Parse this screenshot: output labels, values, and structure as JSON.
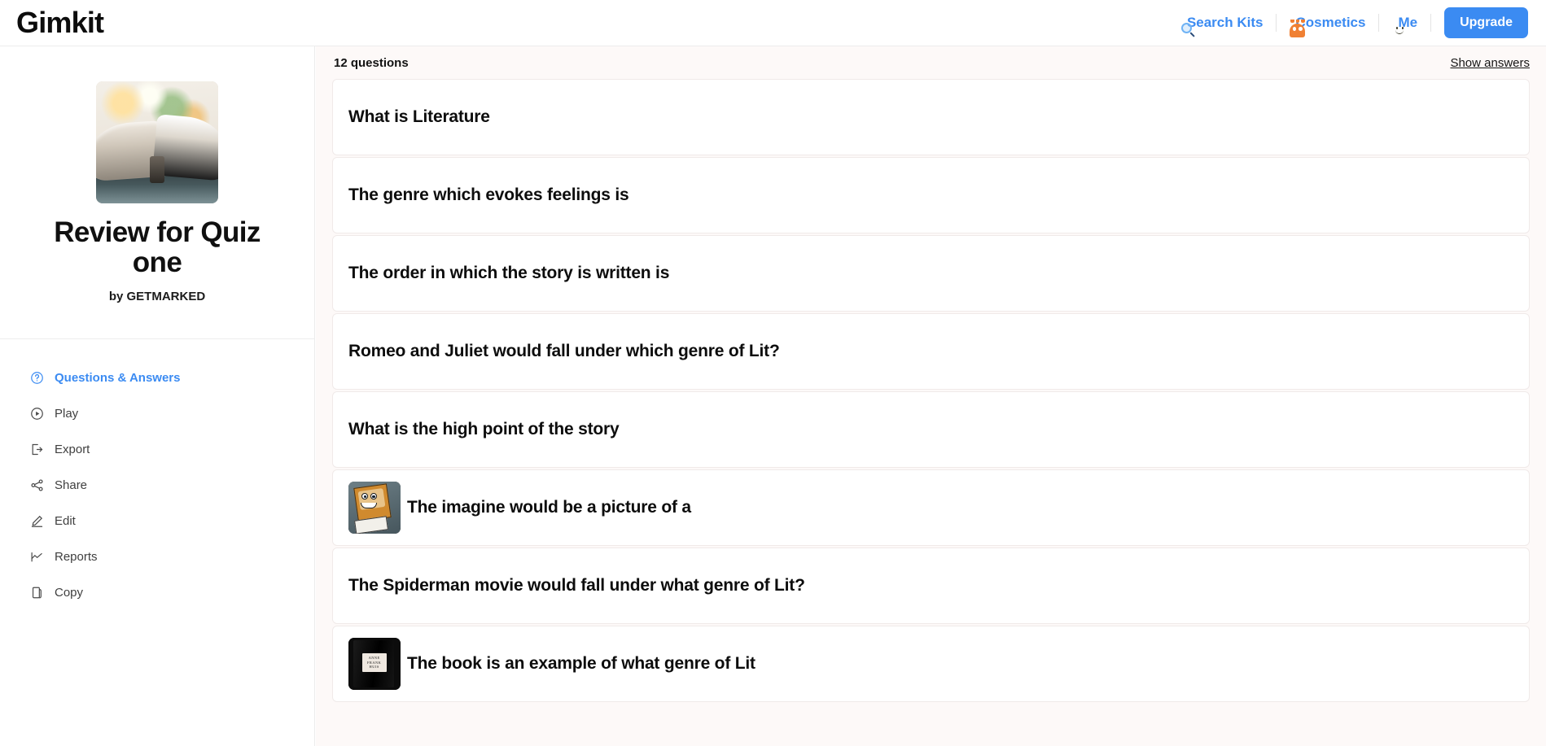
{
  "brand": "Gimkit",
  "nav": {
    "search_label": "Search Kits",
    "search_icon": "magnifier-icon",
    "cosmetics_label": "Cosmetics",
    "cosmetics_icon": "monster-avatar-icon",
    "me_label": "Me",
    "me_icon": "smiley-avatar-icon",
    "upgrade_label": "Upgrade",
    "accent_color": "#3b8bf2"
  },
  "sidebar": {
    "kit_title": "Review for Quiz one",
    "kit_author": "by GETMARKED",
    "thumbnail_alt": "open-book-photo",
    "items": [
      {
        "label": "Questions & Answers",
        "icon": "question-circle-icon",
        "active": true
      },
      {
        "label": "Play",
        "icon": "play-circle-icon",
        "active": false
      },
      {
        "label": "Export",
        "icon": "export-icon",
        "active": false
      },
      {
        "label": "Share",
        "icon": "share-icon",
        "active": false
      },
      {
        "label": "Edit",
        "icon": "pencil-icon",
        "active": false
      },
      {
        "label": "Reports",
        "icon": "chart-line-icon",
        "active": false
      },
      {
        "label": "Copy",
        "icon": "copy-icon",
        "active": false
      }
    ]
  },
  "main": {
    "question_count": "12 questions",
    "show_answers_label": "Show answers",
    "questions": [
      {
        "text": "What is Literature",
        "image": null
      },
      {
        "text": "The genre which evokes feelings is",
        "image": null
      },
      {
        "text": "The order in which the story is written is",
        "image": null
      },
      {
        "text": "Romeo and Juliet would fall under which genre of Lit?",
        "image": null
      },
      {
        "text": "What is the high point of the story",
        "image": null
      },
      {
        "text": "The imagine would be a picture of a",
        "image": "spongebob-thumbnail"
      },
      {
        "text": "The Spiderman movie would fall under what genre of Lit?",
        "image": null
      },
      {
        "text": "The book is an example of what genre of Lit",
        "image": "anne-frank-book-thumbnail"
      }
    ],
    "book_cover_lines": [
      "ANNE",
      "FRANK",
      "HUIS"
    ]
  }
}
